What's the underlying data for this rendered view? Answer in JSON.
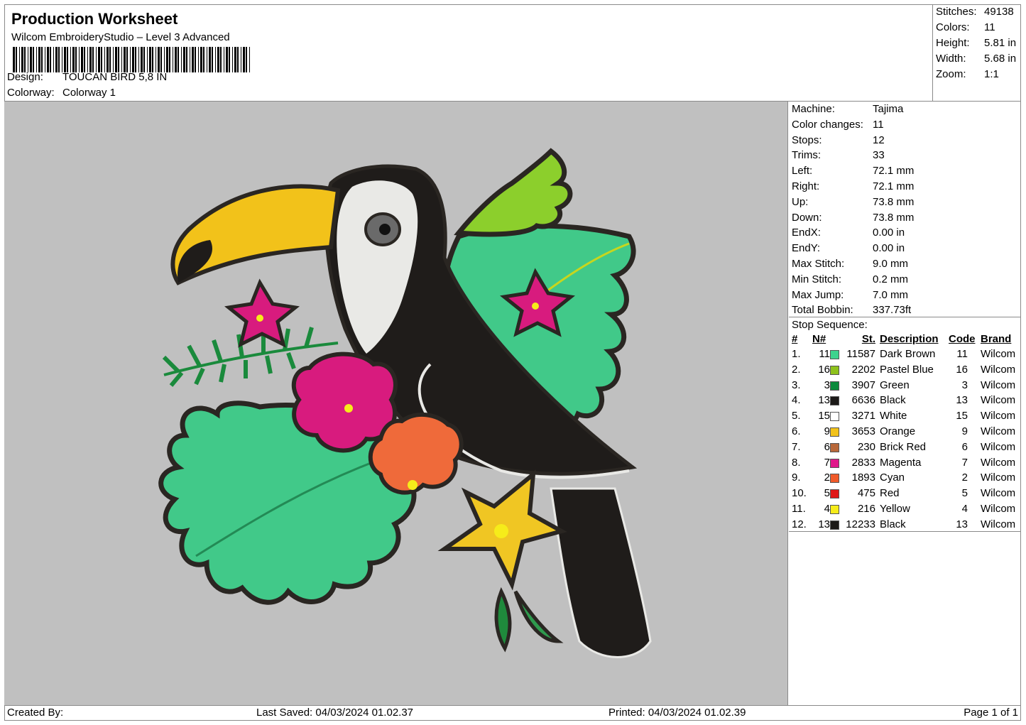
{
  "header": {
    "title": "Production Worksheet",
    "software": "Wilcom EmbroideryStudio – Level 3 Advanced",
    "design_label": "Design:",
    "design_value": "TOUCAN BIRD 5,8 IN",
    "colorway_label": "Colorway:",
    "colorway_value": "Colorway 1"
  },
  "stats": [
    {
      "label": "Stitches:",
      "value": "49138"
    },
    {
      "label": "Colors:",
      "value": "11"
    },
    {
      "label": "Height:",
      "value": "5.81 in"
    },
    {
      "label": "Width:",
      "value": "5.68 in"
    },
    {
      "label": "Zoom:",
      "value": "1:1"
    }
  ],
  "machine": [
    {
      "label": "Machine:",
      "value": "Tajima"
    },
    {
      "label": "Color changes:",
      "value": "11"
    },
    {
      "label": "Stops:",
      "value": "12"
    },
    {
      "label": "Trims:",
      "value": "33"
    },
    {
      "label": "Left:",
      "value": "72.1 mm"
    },
    {
      "label": "Right:",
      "value": "72.1 mm"
    },
    {
      "label": "Up:",
      "value": "73.8 mm"
    },
    {
      "label": "Down:",
      "value": "73.8 mm"
    },
    {
      "label": "EndX:",
      "value": "0.00 in"
    },
    {
      "label": "EndY:",
      "value": "0.00 in"
    },
    {
      "label": "Max Stitch:",
      "value": "9.0 mm"
    },
    {
      "label": "Min Stitch:",
      "value": "0.2 mm"
    },
    {
      "label": "Max Jump:",
      "value": "7.0 mm"
    },
    {
      "label": "Total Bobbin:",
      "value": "337.73ft"
    }
  ],
  "stop_sequence": {
    "title": "Stop Sequence:",
    "columns": {
      "num": "#",
      "n": "N#",
      "st": "St.",
      "desc": "Description",
      "code": "Code",
      "brand": "Brand"
    },
    "rows": [
      {
        "num": "1.",
        "n": "11",
        "color": "#3ed38e",
        "st": "11587",
        "desc": "Dark Brown",
        "code": "11",
        "brand": "Wilcom"
      },
      {
        "num": "2.",
        "n": "16",
        "color": "#8ec21c",
        "st": "2202",
        "desc": "Pastel Blue",
        "code": "16",
        "brand": "Wilcom"
      },
      {
        "num": "3.",
        "n": "3",
        "color": "#0b8a3c",
        "st": "3907",
        "desc": "Green",
        "code": "3",
        "brand": "Wilcom"
      },
      {
        "num": "4.",
        "n": "13",
        "color": "#1c1a18",
        "st": "6636",
        "desc": "Black",
        "code": "13",
        "brand": "Wilcom"
      },
      {
        "num": "5.",
        "n": "15",
        "color": "#ffffff",
        "st": "3271",
        "desc": "White",
        "code": "15",
        "brand": "Wilcom"
      },
      {
        "num": "6.",
        "n": "9",
        "color": "#f2c21a",
        "st": "3653",
        "desc": "Orange",
        "code": "9",
        "brand": "Wilcom"
      },
      {
        "num": "7.",
        "n": "6",
        "color": "#b8683a",
        "st": "230",
        "desc": "Brick Red",
        "code": "6",
        "brand": "Wilcom"
      },
      {
        "num": "8.",
        "n": "7",
        "color": "#e0188a",
        "st": "2833",
        "desc": "Magenta",
        "code": "7",
        "brand": "Wilcom"
      },
      {
        "num": "9.",
        "n": "2",
        "color": "#f05a2a",
        "st": "1893",
        "desc": "Cyan",
        "code": "2",
        "brand": "Wilcom"
      },
      {
        "num": "10.",
        "n": "5",
        "color": "#e01818",
        "st": "475",
        "desc": "Red",
        "code": "5",
        "brand": "Wilcom"
      },
      {
        "num": "11.",
        "n": "4",
        "color": "#f6ec1a",
        "st": "216",
        "desc": "Yellow",
        "code": "4",
        "brand": "Wilcom"
      },
      {
        "num": "12.",
        "n": "13",
        "color": "#1c1a18",
        "st": "12233",
        "desc": "Black",
        "code": "13",
        "brand": "Wilcom"
      }
    ]
  },
  "footer": {
    "created_by": "Created By:",
    "last_saved": "Last Saved: 04/03/2024 01.02.37",
    "printed": "Printed: 04/03/2024 01.02.39",
    "page": "Page 1 of 1"
  },
  "design_colors": {
    "canvas_bg": "#c0c0c0",
    "leaf": "#41c989",
    "leaf_light": "#8ccf2c",
    "outline": "#2a2622",
    "beak": "#f2c21a",
    "face": "#e9e9e6",
    "body": "#1f1c1a",
    "magenta": "#d81b7e",
    "orange": "#ef6a3a",
    "yellow_flower": "#f0c623"
  }
}
